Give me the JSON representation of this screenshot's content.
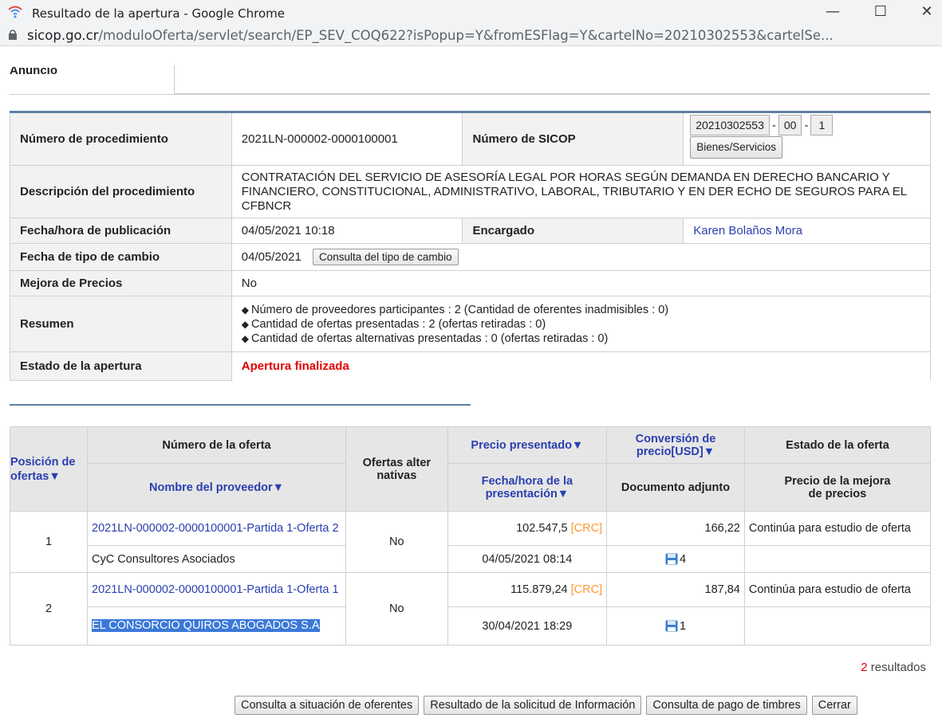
{
  "window": {
    "title": "Resultado de la apertura - Google Chrome",
    "url_host": "sicop.go.cr",
    "url_path": "/moduloOferta/servlet/search/EP_SEV_COQ622?isPopup=Y&fromESFlag=Y&cartelNo=20210302553&cartelSe...",
    "minimize": "—",
    "maximize": "☐",
    "close": "✕"
  },
  "anuncio_label": "Anuncio",
  "details": {
    "numero_procedimiento_label": "Número de procedimiento",
    "numero_procedimiento": "2021LN-000002-0000100001",
    "numero_sicop_label": "Número de SICOP",
    "sicop_no": "20210302553",
    "sicop_seq": "00",
    "sicop_num": "1",
    "bienes_button": "Bienes/Servicios",
    "descripcion_label": "Descripción del procedimiento",
    "descripcion": "CONTRATACIÓN DEL SERVICIO DE ASESORÍA LEGAL POR HORAS SEGÚN DEMANDA EN DERECHO BANCARIO Y FINANCIERO, CONSTITUCIONAL, ADMINISTRATIVO, LABORAL, TRIBUTARIO Y EN DER ECHO DE SEGUROS PARA EL CFBNCR",
    "fecha_publicacion_label": "Fecha/hora de publicación",
    "fecha_publicacion": "04/05/2021 10:18",
    "encargado_label": "Encargado",
    "encargado": "Karen Bolaños Mora",
    "fecha_cambio_label": "Fecha de tipo de cambio",
    "fecha_cambio": "04/05/2021",
    "consulta_cambio_button": "Consulta del tipo de cambio",
    "mejora_label": "Mejora de Precios",
    "mejora": "No",
    "resumen_label": "Resumen",
    "resumen": [
      "Número de proveedores participantes : 2  (Cantidad de oferentes inadmisibles : 0)",
      "Cantidad de ofertas presentadas : 2  (ofertas retiradas : 0)",
      "Cantidad de ofertas alternativas presentadas : 0  (ofertas retiradas : 0)"
    ],
    "estado_label": "Estado de la apertura",
    "estado": "Apertura finalizada"
  },
  "results": {
    "headers": {
      "posicion": "Posición de ofertas▼",
      "numero_oferta": "Número de la oferta",
      "nombre_proveedor": "Nombre del proveedor▼",
      "alternativas": "Ofertas alter nativas",
      "precio": "Precio presentado▼",
      "fecha": "Fecha/hora de la presentación▼",
      "conversion": "Conversión de precio[USD]▼",
      "documento": "Documento adjunto",
      "estado": "Estado de la oferta",
      "mejora": "Precio de la mejora de precios"
    },
    "rows": [
      {
        "pos": "1",
        "oferta": "2021LN-000002-0000100001-Partida 1-Oferta 2",
        "proveedor": "CyC Consultores Asociados",
        "alternativas": "No",
        "precio": "102.547,5",
        "moneda": "[CRC]",
        "fecha": "04/05/2021 08:14",
        "conversion": "166,22",
        "documentos": "4",
        "estado": "Continúa para estudio de oferta"
      },
      {
        "pos": "2",
        "oferta": "2021LN-000002-0000100001-Partida 1-Oferta 1",
        "proveedor": "EL CONSORCIO QUIROS ABOGADOS S.A",
        "alternativas": "No",
        "precio": "115.879,24",
        "moneda": "[CRC]",
        "fecha": "30/04/2021 18:29",
        "conversion": "187,84",
        "documentos": "1",
        "estado": "Continúa para estudio de oferta"
      }
    ],
    "count": "2",
    "count_label": "resultados"
  },
  "buttons": {
    "situacion": "Consulta a situación de oferentes",
    "solicitud": "Resultado de la solicitud de Información",
    "timbres": "Consulta de pago de timbres",
    "cerrar": "Cerrar"
  }
}
